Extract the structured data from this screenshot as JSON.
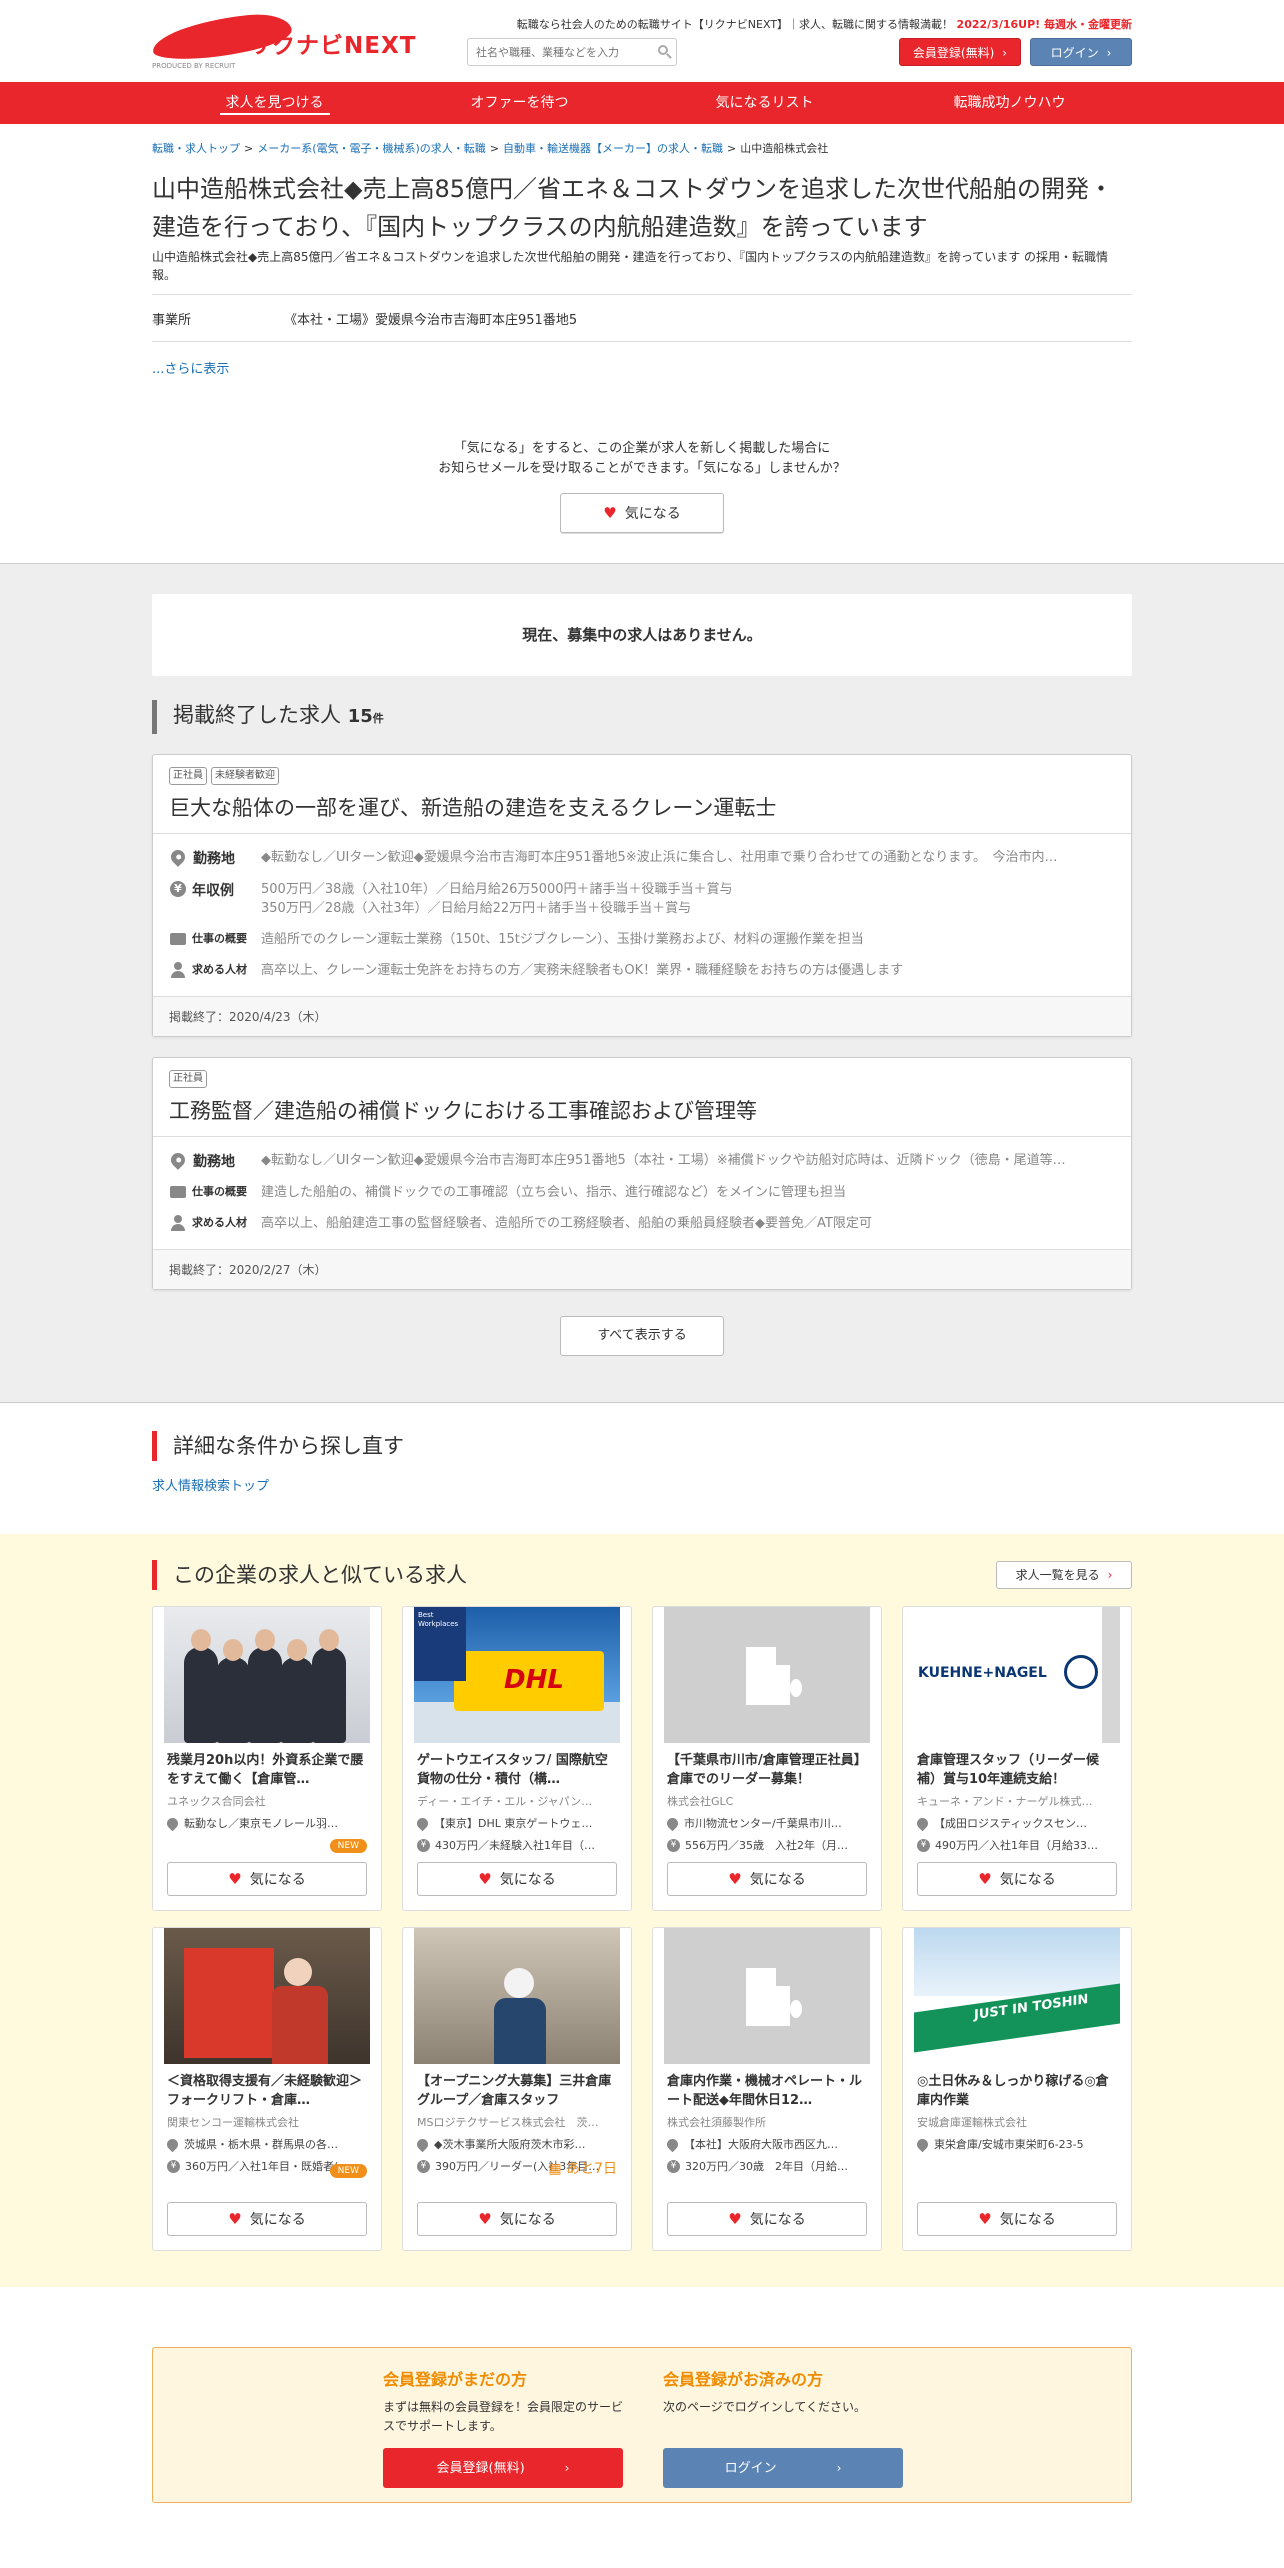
{
  "header": {
    "logo_text": "リクナビNEXT",
    "logo_sub": "PRODUCED BY RECRUIT",
    "tagline": "転職なら社会人のための転職サイト【リクナビNEXT】｜求人、転職に関する情報満載！",
    "update_note": "2022/3/16UP! 毎週水・金曜更新",
    "search_placeholder": "社名や職種、業種などを入力",
    "register_label": "会員登録(無料)",
    "login_label": "ログイン"
  },
  "nav": [
    "求人を見つける",
    "オファーを待つ",
    "気になるリスト",
    "転職成功ノウハウ"
  ],
  "breadcrumb": [
    "転職・求人トップ",
    "メーカー系(電気・電子・機械系)の求人・転職",
    "自動車・輸送機器【メーカー】の求人・転職",
    "山中造船株式会社"
  ],
  "company": {
    "title": "山中造船株式会社◆売上高85億円／省エネ＆コストダウンを追求した次世代船舶の開発・建造を行っており、『国内トップクラスの内航船建造数』を誇っています",
    "desc": "山中造船株式会社◆売上高85億円／省エネ＆コストダウンを追求した次世代船舶の開発・建造を行っており、『国内トップクラスの内航船建造数』を誇っています の採用・転職情報。",
    "office_label": "事業所",
    "office_value": "《本社・工場》愛媛県今治市吉海町本庄951番地5",
    "more": "...さらに表示"
  },
  "fav_prompt": {
    "line1": "「気になる」をすると、この企業が求人を新しく掲載した場合に",
    "line2": "お知らせメールを受け取ることができます。「気になる」しませんか？",
    "button": "気になる"
  },
  "no_jobs": "現在、募集中の求人はありません。",
  "ended": {
    "title": "掲載終了した求人",
    "count": "15",
    "unit": "件",
    "jobs": [
      {
        "tags": [
          "正社員",
          "未経験者歓迎"
        ],
        "title": "巨大な船体の一部を運び、新造船の建造を支えるクレーン運転士",
        "location_label": "勤務地",
        "location": "◆転勤なし／UIターン歓迎◆愛媛県今治市吉海町本庄951番地5※波止浜に集合し、社用車で乗り合わせての通勤となります。　今治市内…",
        "salary_label": "年収例",
        "salary1": "500万円／38歳（入社10年）／日給月給26万5000円＋諸手当＋役職手当＋賞与",
        "salary2": "350万円／28歳（入社3年）／日給月給22万円＋諸手当＋役職手当＋賞与",
        "work_label": "仕事の概要",
        "work": "造船所でのクレーン運転士業務（150t、15tジブクレーン）、玉掛け業務および、材料の運搬作業を担当",
        "req_label": "求める人材",
        "req": "高卒以上、クレーン運転士免許をお持ちの方／実務未経験者もOK！業界・職種経験をお持ちの方は優遇します",
        "ended": "掲載終了：2020/4/23（木）"
      },
      {
        "tags": [
          "正社員"
        ],
        "title": "工務監督／建造船の補償ドックにおける工事確認および管理等",
        "location_label": "勤務地",
        "location": "◆転勤なし／UIターン歓迎◆愛媛県今治市吉海町本庄951番地5（本社・工場）※補償ドックや訪船対応時は、近隣ドック（徳島・尾道等…",
        "work_label": "仕事の概要",
        "work": "建造した船舶の、補償ドックでの工事確認（立ち会い、指示、進行確認など）をメインに管理も担当",
        "req_label": "求める人材",
        "req": "高卒以上、船舶建造工事の監督経験者、造船所での工務経験者、船舶の乗船員経験者◆要普免／AT限定可",
        "ended": "掲載終了：2020/2/27（木）"
      }
    ],
    "show_all": "すべて表示する"
  },
  "search_again": {
    "title": "詳細な条件から探し直す",
    "link": "求人情報検索トップ"
  },
  "similar": {
    "title": "この企業の求人と似ている求人",
    "list_button": "求人一覧を見る",
    "fav_label": "気になる",
    "new_label": "NEW",
    "cards": [
      {
        "title": "残業月20h以内！外資系企業で腰をすえて働く【倉庫管…",
        "company": "ユネックス合同会社",
        "loc": "転勤なし／東京モノレール羽…",
        "salary": "",
        "image": "photo-people"
      },
      {
        "title": "ゲートウエイスタッフ/ 国際航空貨物の仕分・積付（構…",
        "company": "ディー・エイチ・エル・ジャパン…",
        "loc": "【東京】DHL 東京ゲートウェ…",
        "salary": "430万円／未経験入社1年目（…",
        "image": "photo-dhl"
      },
      {
        "title": "【千葉県市川市/倉庫管理正社員】倉庫でのリーダー募集！",
        "company": "株式会社GLC",
        "loc": "市川物流センター/千葉県市川…",
        "salary": "556万円／35歳　入社2年（月…",
        "image": "placeholder-building"
      },
      {
        "title": "倉庫管理スタッフ（リーダー候補）賞与10年連続支給！",
        "company": "キューネ・アンド・ナーゲル株式…",
        "loc": "【成田ロジスティックスセン…",
        "salary": "490万円／入社1年目（月給33…",
        "image": "logo-kuehne-nagel"
      },
      {
        "title": "＜資格取得支援有／未経験歓迎＞フォークリフト・倉庫…",
        "company": "関東センコー運輸株式会社",
        "loc": "茨城県・栃木県・群馬県の各…",
        "salary": "360万円／入社1年目・既婚者(…",
        "image": "photo-forklift"
      },
      {
        "title": "【オープニング大募集】三井倉庫グループ／倉庫スタッフ",
        "company": "MSロジテクサービス株式会社　茨…",
        "loc": "◆茨木事業所大阪府茨木市彩…",
        "salary": "390万円／リーダー(入社3年目…",
        "image": "photo-warehouse-worker",
        "remain": "あと7日"
      },
      {
        "title": "倉庫内作業・機械オペレート・ルート配送◆年間休日12…",
        "company": "株式会社須藤製作所",
        "loc": "【本社】大阪府大阪市西区九…",
        "salary": "320万円／30歳　2年目（月給…",
        "image": "placeholder-building"
      },
      {
        "title": "◎土日休み＆しっかり稼げる◎倉庫内作業",
        "company": "安城倉庫運輸株式会社",
        "loc": "東栄倉庫/安城市東栄町6-23-5",
        "salary": "",
        "image": "photo-toshin"
      }
    ],
    "brands": {
      "best": "Best Workplaces",
      "dhl": "DHL",
      "kn": "KUEHNE+NAGEL",
      "toshin": "JUST IN TOSHIN"
    }
  },
  "member": {
    "new_title": "会員登録がまだの方",
    "new_text": "まずは無料の会員登録を！会員限定のサービスでサポートします。",
    "new_btn": "会員登録(無料)",
    "existing_title": "会員登録がお済みの方",
    "existing_text": "次のページでログインしてください。",
    "existing_btn": "ログイン"
  },
  "colors": {
    "brand_red": "#e8262b",
    "login_blue": "#5b83b4",
    "accent_orange": "#f08c00"
  }
}
